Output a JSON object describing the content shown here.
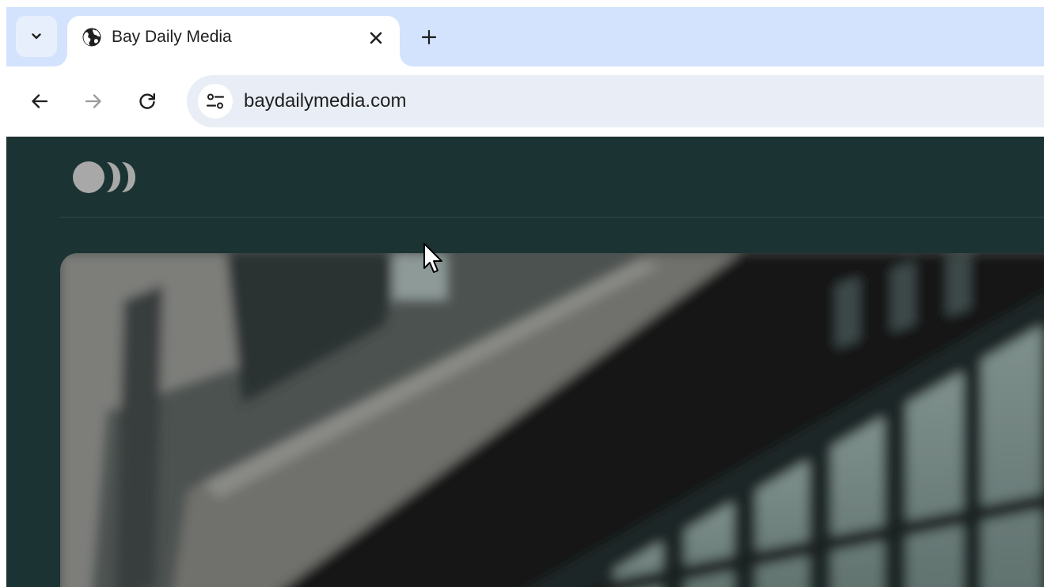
{
  "browser": {
    "tab": {
      "title": "Bay Daily Media",
      "favicon_icon": "globe-icon"
    },
    "tab_search_icon": "chevron-down-icon",
    "new_tab_icon": "plus-icon",
    "close_tab_icon": "close-icon",
    "nav": {
      "back_icon": "arrow-left-icon",
      "forward_icon": "arrow-right-icon",
      "reload_icon": "reload-icon"
    },
    "address_bar": {
      "url": "baydailymedia.com",
      "site_info_icon": "tune-icon"
    },
    "colors": {
      "tabstrip_bg": "#d3e3fd",
      "omnibox_bg": "#e9eef6"
    }
  },
  "page": {
    "logo_icon": "brand-logo-icon",
    "background_color": "#1b3333",
    "hero_image": "blurred-building-facade-image"
  }
}
